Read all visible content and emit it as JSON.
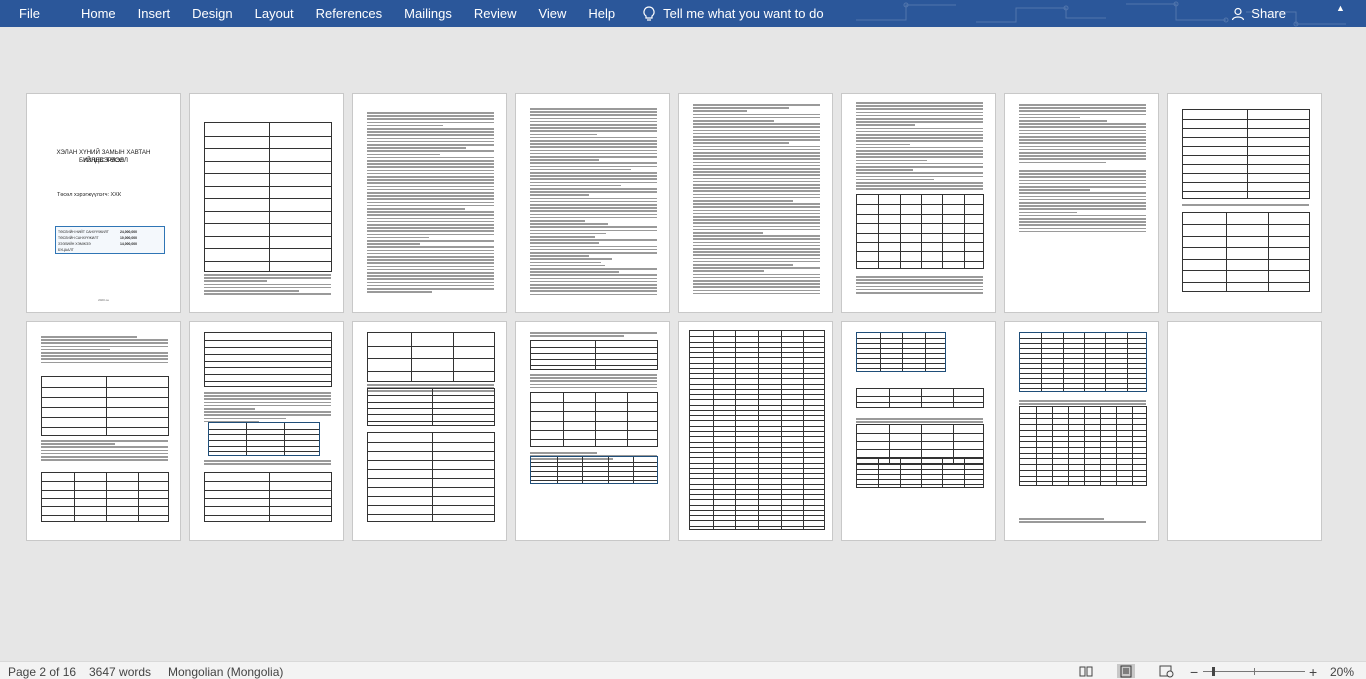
{
  "ribbon": {
    "tabs": [
      "File",
      "Home",
      "Insert",
      "Design",
      "Layout",
      "References",
      "Mailings",
      "Review",
      "View",
      "Help"
    ],
    "tell_me": "Tell me what you want to do",
    "share": "Share",
    "accent_color": "#2b579a"
  },
  "cover": {
    "title_line1": "ХЭЛАН ХҮНИЙ ЗАМЫН ХАВТАН ҮЙЛДВЭРЛЭЛ",
    "title_line2": "БИЗНЕС ТӨСӨЛ",
    "subtitle": "Төсөл хэрэгжүүлэгч: ХХК",
    "rows": [
      [
        "ТӨСЛИЙН НИЙТ САНХҮҮЖИЛТ",
        "24,000,000"
      ],
      [
        "ТӨСЛИЙН САНХҮҮЖИЛТ",
        "10,000,000"
      ],
      [
        "ЗЭЭЛИЙН ХЭМЖЭЭ",
        "14,000,000"
      ],
      [
        "БУЦААЛТ",
        ""
      ]
    ],
    "date": "2020 он"
  },
  "status": {
    "page": "Page 2 of 16",
    "words": "3647 words",
    "language": "Mongolian (Mongolia)",
    "zoom": "20%"
  },
  "icons": [
    "lightbulb-icon",
    "person-icon",
    "read-mode-icon",
    "print-layout-icon",
    "web-layout-icon",
    "zoom-out-icon",
    "zoom-in-icon"
  ]
}
